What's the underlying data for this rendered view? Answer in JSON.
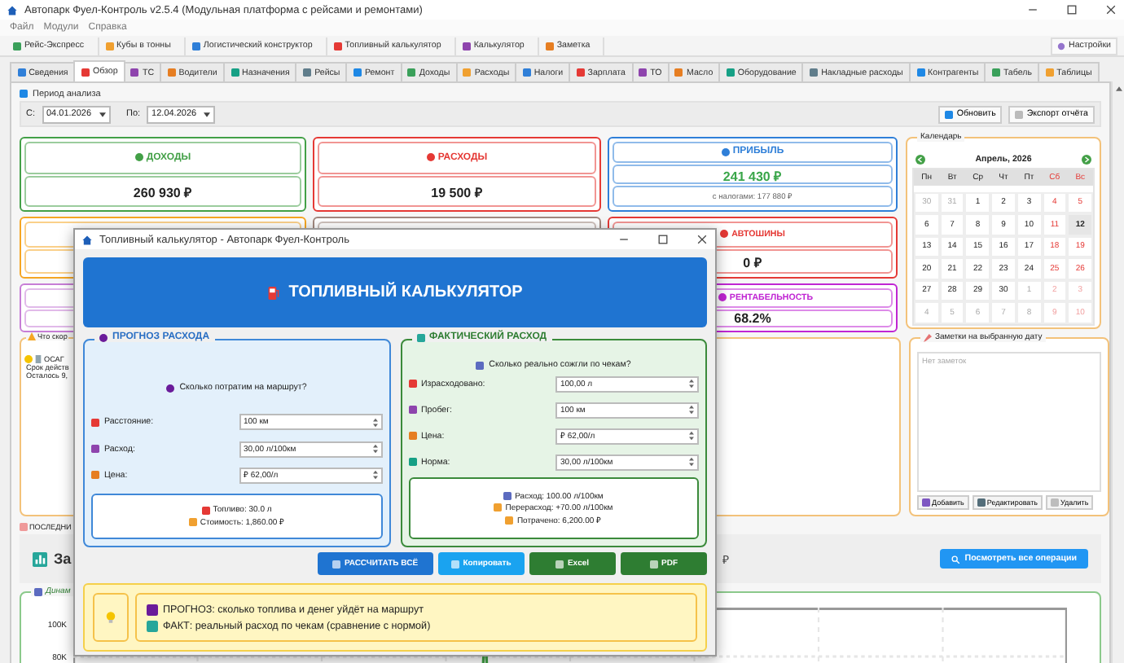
{
  "window": {
    "title": "Автопарк Фуел-Контроль v2.5.4 (Модульная платформа с рейсами и ремонтами)"
  },
  "menu": [
    {
      "label": "Файл"
    },
    {
      "label": "Модули"
    },
    {
      "label": "Справка"
    }
  ],
  "toolbar": {
    "items": [
      {
        "label": "Рейс-Экспресс"
      },
      {
        "label": "Кубы в тонны"
      },
      {
        "label": "Логистический конструктор"
      },
      {
        "label": "Топливный калькулятор"
      },
      {
        "label": "Калькулятор"
      },
      {
        "label": "Заметка"
      }
    ],
    "settings": "Настройки"
  },
  "tabs": [
    {
      "label": "Сведения",
      "selected": false
    },
    {
      "label": "Обзор",
      "selected": true
    },
    {
      "label": "ТС",
      "selected": false
    },
    {
      "label": "Водители",
      "selected": false
    },
    {
      "label": "Назначения",
      "selected": false
    },
    {
      "label": "Рейсы",
      "selected": false
    },
    {
      "label": "Ремонт",
      "selected": false
    },
    {
      "label": "Доходы",
      "selected": false
    },
    {
      "label": "Расходы",
      "selected": false
    },
    {
      "label": "Налоги",
      "selected": false
    },
    {
      "label": "Зарплата",
      "selected": false
    },
    {
      "label": "ТО",
      "selected": false
    },
    {
      "label": "Масло",
      "selected": false
    },
    {
      "label": "Оборудование",
      "selected": false
    },
    {
      "label": "Накладные расходы",
      "selected": false
    },
    {
      "label": "Контрагенты",
      "selected": false
    },
    {
      "label": "Табель",
      "selected": false
    },
    {
      "label": "Таблицы",
      "selected": false
    }
  ],
  "period": {
    "title": "Период анализа",
    "from_label": "С:",
    "from": "04.01.2026",
    "to_label": "По:",
    "to": "12.04.2026",
    "buttons": [
      "Обновить",
      "Экспорт отчёта"
    ]
  },
  "card_rows": [
    [
      {
        "kind": "metric",
        "title": "ДОХОДЫ",
        "value": "260 930 ₽",
        "color": "#43a047"
      },
      {
        "kind": "metric",
        "title": "РАСХОДЫ",
        "value": "19 500 ₽",
        "color": "#e53935"
      },
      {
        "kind": "profit",
        "title": "ПРИБЫЛЬ",
        "value": "241 430 ₽",
        "note": "с налогами: 177 880 ₽",
        "color": "#2f7fd8"
      }
    ],
    [
      {
        "kind": "hidden",
        "color": "#f5a623"
      },
      {
        "kind": "hidden",
        "color": "#a1887f"
      },
      {
        "kind": "metric",
        "title": "АВТОШИНЫ",
        "value": "0 ₽",
        "color": "#e53935"
      }
    ],
    [
      {
        "kind": "hidden",
        "color": "#c77dd6"
      },
      {
        "kind": "metric",
        "title": "РЕНТАБЕЛЬНОСТЬ",
        "value": "68.2%",
        "color": "#c026d3"
      }
    ]
  ],
  "calendar": {
    "title": "Календарь",
    "month": "Апрель,  2026",
    "weekdays": [
      {
        "label": "Пн",
        "weekend": false
      },
      {
        "label": "Вт",
        "weekend": false
      },
      {
        "label": "Ср",
        "weekend": false
      },
      {
        "label": "Чт",
        "weekend": false
      },
      {
        "label": "Пт",
        "weekend": false
      },
      {
        "label": "Сб",
        "weekend": true
      },
      {
        "label": "Вс",
        "weekend": true
      }
    ],
    "weeks": [
      [
        {
          "day": "30",
          "muted": true,
          "selected": false
        },
        {
          "day": "31",
          "muted": true,
          "selected": false
        },
        {
          "day": "1",
          "muted": false,
          "selected": false
        },
        {
          "day": "2",
          "muted": false,
          "selected": false
        },
        {
          "day": "3",
          "muted": false,
          "selected": false
        },
        {
          "day": "4",
          "muted": false,
          "selected": false
        },
        {
          "day": "5",
          "muted": false,
          "selected": false
        }
      ],
      [
        {
          "day": "6",
          "muted": false,
          "selected": false
        },
        {
          "day": "7",
          "muted": false,
          "selected": false
        },
        {
          "day": "8",
          "muted": false,
          "selected": false
        },
        {
          "day": "9",
          "muted": false,
          "selected": false
        },
        {
          "day": "10",
          "muted": false,
          "selected": false
        },
        {
          "day": "11",
          "muted": false,
          "selected": false
        },
        {
          "day": "12",
          "muted": false,
          "selected": true
        }
      ],
      [
        {
          "day": "13",
          "muted": false,
          "selected": false
        },
        {
          "day": "14",
          "muted": false,
          "selected": false
        },
        {
          "day": "15",
          "muted": false,
          "selected": false
        },
        {
          "day": "16",
          "muted": false,
          "selected": false
        },
        {
          "day": "17",
          "muted": false,
          "selected": false
        },
        {
          "day": "18",
          "muted": false,
          "selected": false
        },
        {
          "day": "19",
          "muted": false,
          "selected": false
        }
      ],
      [
        {
          "day": "20",
          "muted": false,
          "selected": false
        },
        {
          "day": "21",
          "muted": false,
          "selected": false
        },
        {
          "day": "22",
          "muted": false,
          "selected": false
        },
        {
          "day": "23",
          "muted": false,
          "selected": false
        },
        {
          "day": "24",
          "muted": false,
          "selected": false
        },
        {
          "day": "25",
          "muted": false,
          "selected": false
        },
        {
          "day": "26",
          "muted": false,
          "selected": false
        }
      ],
      [
        {
          "day": "27",
          "muted": false,
          "selected": false
        },
        {
          "day": "28",
          "muted": false,
          "selected": false
        },
        {
          "day": "29",
          "muted": false,
          "selected": false
        },
        {
          "day": "30",
          "muted": false,
          "selected": false
        },
        {
          "day": "1",
          "muted": true,
          "selected": false
        },
        {
          "day": "2",
          "muted": true,
          "selected": false
        },
        {
          "day": "3",
          "muted": true,
          "selected": false
        }
      ],
      [
        {
          "day": "4",
          "muted": true,
          "selected": false
        },
        {
          "day": "5",
          "muted": true,
          "selected": false
        },
        {
          "day": "6",
          "muted": true,
          "selected": false
        },
        {
          "day": "7",
          "muted": true,
          "selected": false
        },
        {
          "day": "8",
          "muted": true,
          "selected": false
        },
        {
          "day": "9",
          "muted": true,
          "selected": false
        },
        {
          "day": "10",
          "muted": true,
          "selected": false
        }
      ]
    ]
  },
  "alerts": {
    "title": "Что скор",
    "items": [
      {
        "title": "ОСАГ",
        "lines": [
          "Срок действ",
          "Осталось 9,"
        ]
      }
    ]
  },
  "notes": {
    "title": "Заметки на выбранную дату",
    "empty": "Нет заметок",
    "buttons": [
      "Добавить",
      "Редактировать",
      "Удалить"
    ]
  },
  "recent": {
    "title": "ПОСЛЕДНИ",
    "summary": "За",
    "summary_tail": "₽",
    "button": "Посмотреть все операции"
  },
  "chart": {
    "title": "Динам",
    "y_labels": [
      "100K",
      "80K"
    ]
  },
  "dialog": {
    "title": "Топливный калькулятор - Автопарк Фуел-Контроль",
    "header": "ТОПЛИВНЫЙ КАЛЬКУЛЯТОР",
    "forecast": {
      "title": "ПРОГНОЗ РАСХОДА",
      "question": "Сколько потратим на маршрут?",
      "fields": [
        {
          "label": "Расстояние:",
          "value": "100 км"
        },
        {
          "label": "Расход:",
          "value": "30,00 л/100км"
        },
        {
          "label": "Цена:",
          "value": "₽ 62,00/л"
        }
      ],
      "results": [
        "Топливо: 30.0 л",
        "Стоимость: 1,860.00 ₽"
      ]
    },
    "actual": {
      "title": "ФАКТИЧЕСКИЙ РАСХОД",
      "question": "Сколько реально сожгли по чекам?",
      "fields": [
        {
          "label": "Израсходовано:",
          "value": "100,00 л"
        },
        {
          "label": "Пробег:",
          "value": "100 км"
        },
        {
          "label": "Цена:",
          "value": "₽ 62,00/л"
        },
        {
          "label": "Норма:",
          "value": "30,00 л/100км"
        }
      ],
      "results": [
        "Расход: 100.00 л/100км",
        "Перерасход: +70.00 л/100км",
        "Потрачено: 6,200.00 ₽"
      ]
    },
    "buttons": [
      {
        "label": "РАССЧИТАТЬ ВСЁ",
        "kind": "primary"
      },
      {
        "label": "Копировать",
        "kind": "info"
      },
      {
        "label": "Excel",
        "kind": "success"
      },
      {
        "label": "PDF",
        "kind": "success"
      }
    ],
    "tips": [
      "ПРОГНОЗ: сколько топлива и денег уйдёт на маршрут",
      "ФАКТ: реальный расход по чекам (сравнение с нормой)"
    ]
  }
}
